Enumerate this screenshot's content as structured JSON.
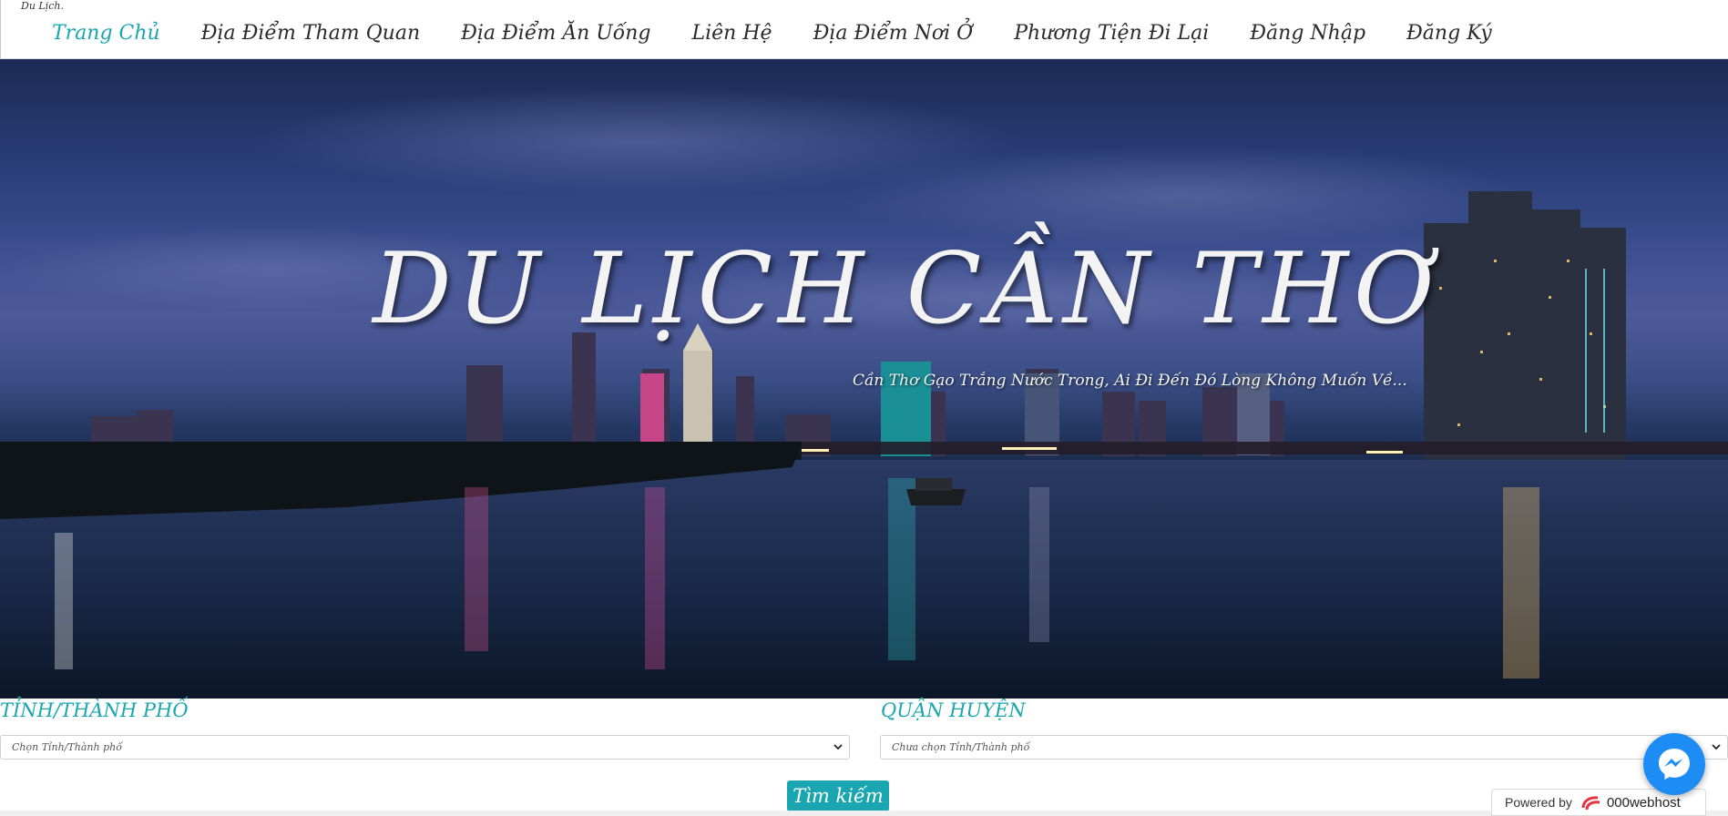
{
  "header": {
    "brand": "Du Lịch.",
    "nav": [
      {
        "label": "Trang Chủ",
        "active": true
      },
      {
        "label": "Địa Điểm Tham Quan",
        "active": false
      },
      {
        "label": "Địa Điểm Ăn Uống",
        "active": false
      },
      {
        "label": "Liên Hệ",
        "active": false
      },
      {
        "label": "Địa Điểm Nơi Ở",
        "active": false
      },
      {
        "label": "Phương Tiện Đi Lại",
        "active": false
      },
      {
        "label": "Đăng Nhập",
        "active": false
      },
      {
        "label": "Đăng Ký",
        "active": false
      }
    ]
  },
  "hero": {
    "title": "DU LỊCH CẦN THƠ",
    "subtitle": "Cần Thơ Gạo Trắng Nước Trong, Ai Đi Đến Đó Lòng Không Muốn Về..."
  },
  "search": {
    "province_label": "TỈNH/THÀNH PHỐ",
    "province_value": "Chọn Tỉnh/Thành phố",
    "district_label": "QUẬN HUYỆN",
    "district_value": "Chưa chọn Tỉnh/Thành phố",
    "submit_label": "Tìm kiếm"
  },
  "widgets": {
    "powered_by": "Powered by",
    "host_name": "000webhost",
    "messenger_icon": "messenger-icon"
  },
  "colors": {
    "accent": "#1aa6b0",
    "messenger": "#1d8df5"
  }
}
